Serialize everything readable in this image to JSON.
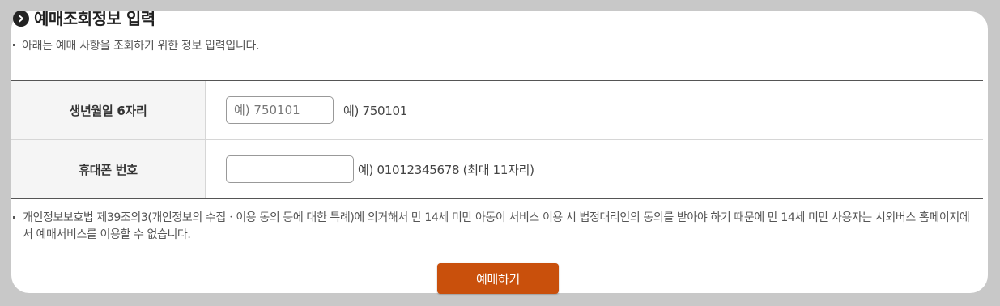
{
  "section": {
    "title": "예매조회정보 입력",
    "intro_note": "아래는 예매 사항을 조회하기 위한 정보 입력입니다."
  },
  "form": {
    "birth": {
      "label": "생년월일 6자리",
      "placeholder": "예) 750101",
      "value": "",
      "hint": "예) 750101"
    },
    "phone": {
      "label": "휴대폰 번호",
      "placeholder": "",
      "value": "",
      "hint": "예) 01012345678 (최대 11자리)"
    }
  },
  "notice": "개인정보보호법 제39조의3(개인정보의 수집ㆍ이용 동의 등에 대한 특례)에 의거해서 만 14세 미만 아동이 서비스 이용 시 법정대리인의 동의를 받아야 하기 때문에 만 14세 미만 사용자는 시외버스 홈페이지에서 예매서비스를 이용할 수 없습니다.",
  "submit_label": "예매하기",
  "colors": {
    "page_background": "#c8c8c8",
    "submit_button": "#c9500c",
    "title_icon": "#222222"
  },
  "icons": {
    "title": "chevron-right-circle-icon"
  }
}
